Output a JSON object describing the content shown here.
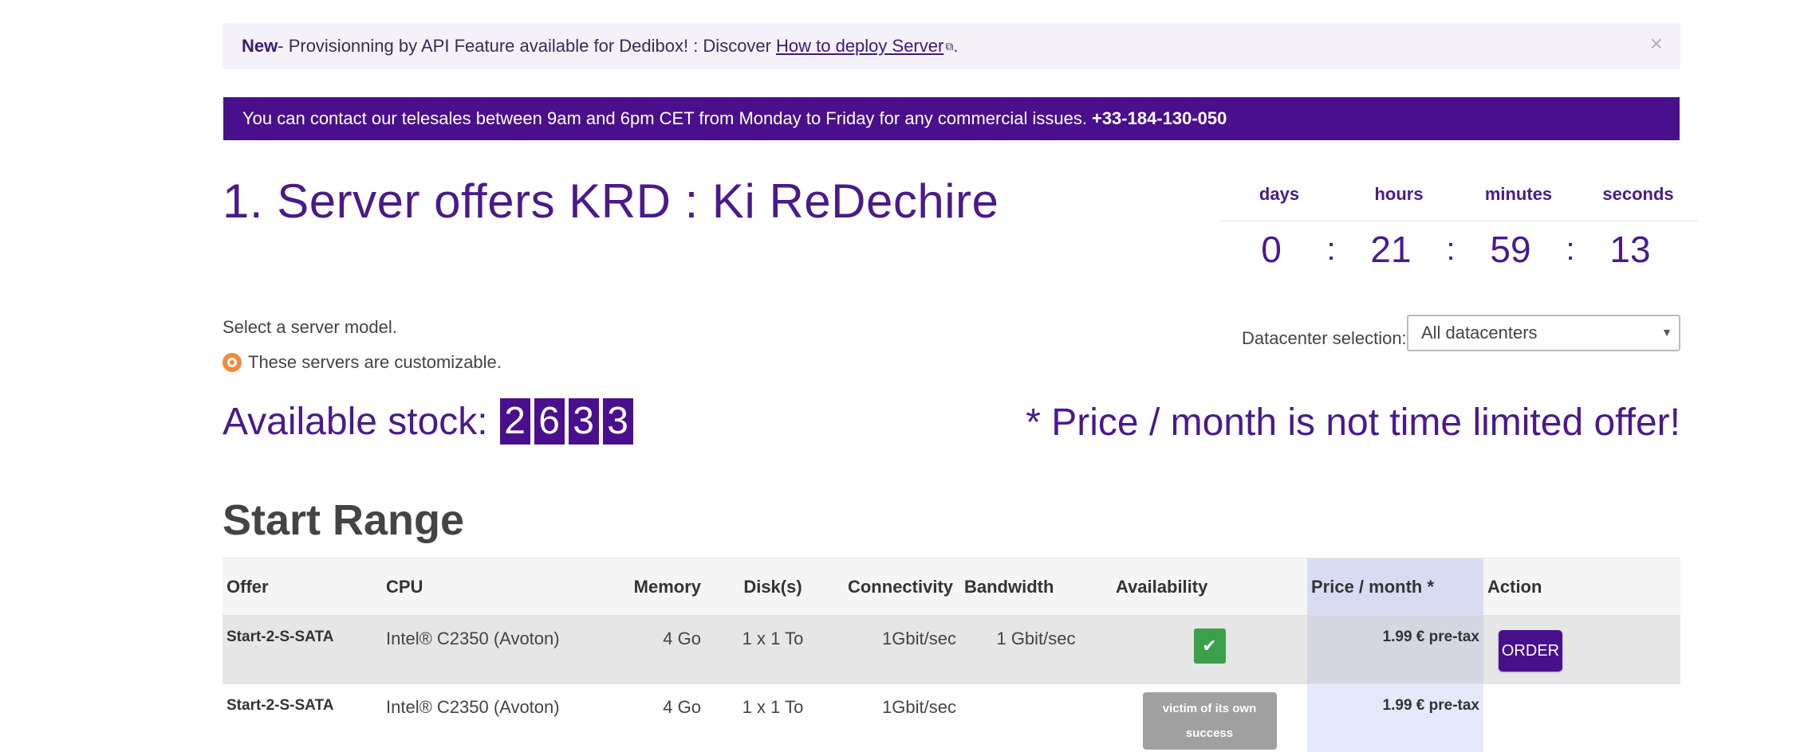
{
  "alert": {
    "new_label": "New",
    "text": " - Provisionning by API Feature available for Dedibox! : Discover",
    "link_text": "How to deploy Server",
    "close": "×"
  },
  "telesales": {
    "text": "You can contact our telesales between 9am and 6pm CET from Monday to Friday for any commercial issues.",
    "phone": "+33-184-130-050"
  },
  "page_title": "1. Server offers KRD : Ki ReDechire",
  "countdown": {
    "labels": [
      "days",
      "hours",
      "minutes",
      "seconds"
    ],
    "values": [
      "0",
      "21",
      "59",
      "13"
    ],
    "separator": ":"
  },
  "intro": {
    "select_text": "Select a server model.",
    "customizable_text": "These servers are customizable."
  },
  "datacenter": {
    "label": "Datacenter selection:",
    "selected": "All datacenters"
  },
  "stock": {
    "label": "Available stock:",
    "digits": [
      "2",
      "6",
      "3",
      "3"
    ]
  },
  "price_note": "* Price / month is not time limited offer!",
  "range_title": "Start Range",
  "table": {
    "headers": [
      "Offer",
      "CPU",
      "Memory",
      "Disk(s)",
      "Connectivity",
      "Bandwidth",
      "Availability",
      "Price / month *",
      "Action"
    ],
    "rows": [
      {
        "offer": "Start-2-S-SATA",
        "cpu": "Intel® C2350 (Avoton)",
        "memory": "4 Go",
        "disks": "1 x 1 To",
        "connectivity": "1Gbit/sec",
        "bandwidth": "1 Gbit/sec",
        "availability": "available",
        "price": "1.99 € pre-tax",
        "action": "ORDER"
      },
      {
        "offer": "Start-2-S-SATA",
        "cpu": "Intel® C2350 (Avoton)",
        "memory": "4 Go",
        "disks": "1 x 1 To",
        "connectivity": "1Gbit/sec",
        "bandwidth": "",
        "availability": "victim of its own success",
        "price": "1.99 € pre-tax",
        "action": ""
      }
    ]
  },
  "colors": {
    "brand_purple": "#4a0f8c",
    "title_purple": "#4a1a8c",
    "available_green": "#3aa04a",
    "customizable_orange": "#f08a3c"
  },
  "icons": {
    "external_link": "external-link-icon",
    "close": "close-icon",
    "customizable": "customizable-icon",
    "available": "check-icon",
    "dropdown": "caret-down-icon"
  }
}
